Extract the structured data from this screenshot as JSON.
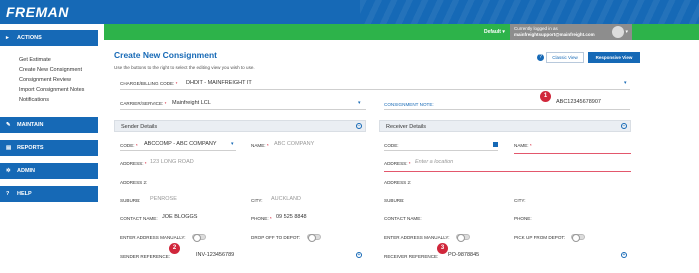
{
  "brand": {
    "logo": "FREMAN"
  },
  "topbar": {
    "default_label": "Default",
    "user_line1": "Currently logged in as",
    "user_line2": "mainfreightsupport@mainfreight.com"
  },
  "sidebar": {
    "actions_label": "ACTIONS",
    "links": [
      "Get Estimate",
      "Create New Consignment",
      "Consignment Review",
      "Import Consignment Notes",
      "Notifications"
    ],
    "sections": [
      "MAINTAIN",
      "REPORTS",
      "ADMIN",
      "HELP"
    ]
  },
  "page": {
    "title": "Create New Consignment",
    "subtitle": "Use the buttons to the right to select the editing view you wish to use.",
    "classic_view": "Classic View",
    "responsive_view": "Responsive View"
  },
  "form": {
    "charge_label": "CHARGE/BILLING CODE:",
    "charge_value": "DHDIT - MAINFREIGHT IT",
    "carrier_label": "CARRIER/SERVICE:",
    "carrier_value": "Mainfreight LCL",
    "consignment_label": "CONSIGNMENT NOTE:",
    "consignment_value": "ABC12345678907"
  },
  "sender": {
    "heading": "Sender Details",
    "code_label": "CODE:",
    "code_value": "ABCCOMP - ABC COMPANY",
    "name_label": "NAME:",
    "name_value": "ABC COMPANY",
    "address_label": "ADDRESS:",
    "address_value": "123 LONG ROAD",
    "address2_label": "ADDRESS 2:",
    "suburb_label": "SUBURB:",
    "suburb_value": "PENROSE",
    "city_label": "CITY:",
    "city_value": "AUCKLAND",
    "contact_label": "CONTACT NAME:",
    "contact_value": "JOE BLOGGS",
    "phone_label": "PHONE:",
    "phone_value": "09 525 8848",
    "manual_label": "ENTER ADDRESS MANUALLY:",
    "dropoff_label": "DROP OFF TO DEPOT:",
    "reference_label": "SENDER REFERENCE:",
    "reference_value": "INV-123456789"
  },
  "receiver": {
    "heading": "Receiver Details",
    "code_label": "CODE:",
    "name_label": "NAME:",
    "address_label": "ADDRESS:",
    "address_placeholder": "Enter a location",
    "address2_label": "ADDRESS 2:",
    "suburb_label": "SUBURB:",
    "city_label": "CITY:",
    "contact_label": "CONTACT NAME:",
    "phone_label": "PHONE:",
    "manual_label": "ENTER ADDRESS MANUALLY:",
    "pickup_label": "PICK UP FROM DEPOT:",
    "reference_label": "RECEIVER REFERENCE:",
    "reference_value": "PO-9878845"
  },
  "badges": [
    "1",
    "2",
    "3"
  ],
  "colors": {
    "brand_blue": "#1669b6",
    "green_bar": "#2db34a",
    "badge_red": "#d0273b"
  }
}
